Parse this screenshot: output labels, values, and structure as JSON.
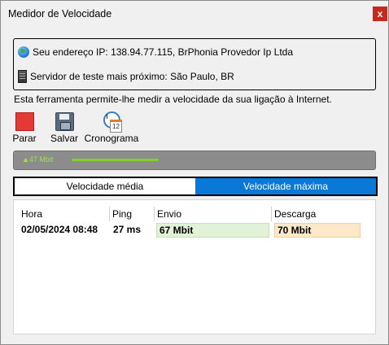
{
  "window": {
    "title": "Medidor de Velocidade",
    "close_label": "x"
  },
  "info": {
    "ip_text": "Seu endereço IP: 138.94.77.115, BrPhonia Provedor Ip Ltda",
    "server_text": "Servidor de teste mais próximo: São Paulo, BR"
  },
  "description": "Esta ferramenta permite-lhe medir a velocidade da sua ligação à Internet.",
  "toolbar": {
    "stop_label": "Parar",
    "save_label": "Salvar",
    "schedule_label": "Cronograma",
    "calendar_day": "12"
  },
  "progress": {
    "label": "▲47 Mbit",
    "fraction": 0.29
  },
  "tabs": [
    {
      "label": "Velocidade média",
      "active": false
    },
    {
      "label": "Velocidade máxima",
      "active": true
    }
  ],
  "table": {
    "headers": [
      "Hora",
      "Ping",
      "Envio",
      "Descarga"
    ],
    "rows": [
      {
        "hora": "02/05/2024 08:48",
        "ping": "27 ms",
        "envio": "67 Mbit",
        "descarga": "70 Mbit"
      }
    ]
  },
  "colors": {
    "accent": "#0a78d7",
    "close": "#c42b1c",
    "stop": "#e53935",
    "progress": "#7ed321",
    "upload_bg": "#e2f2d7",
    "download_bg": "#fde8c8"
  }
}
